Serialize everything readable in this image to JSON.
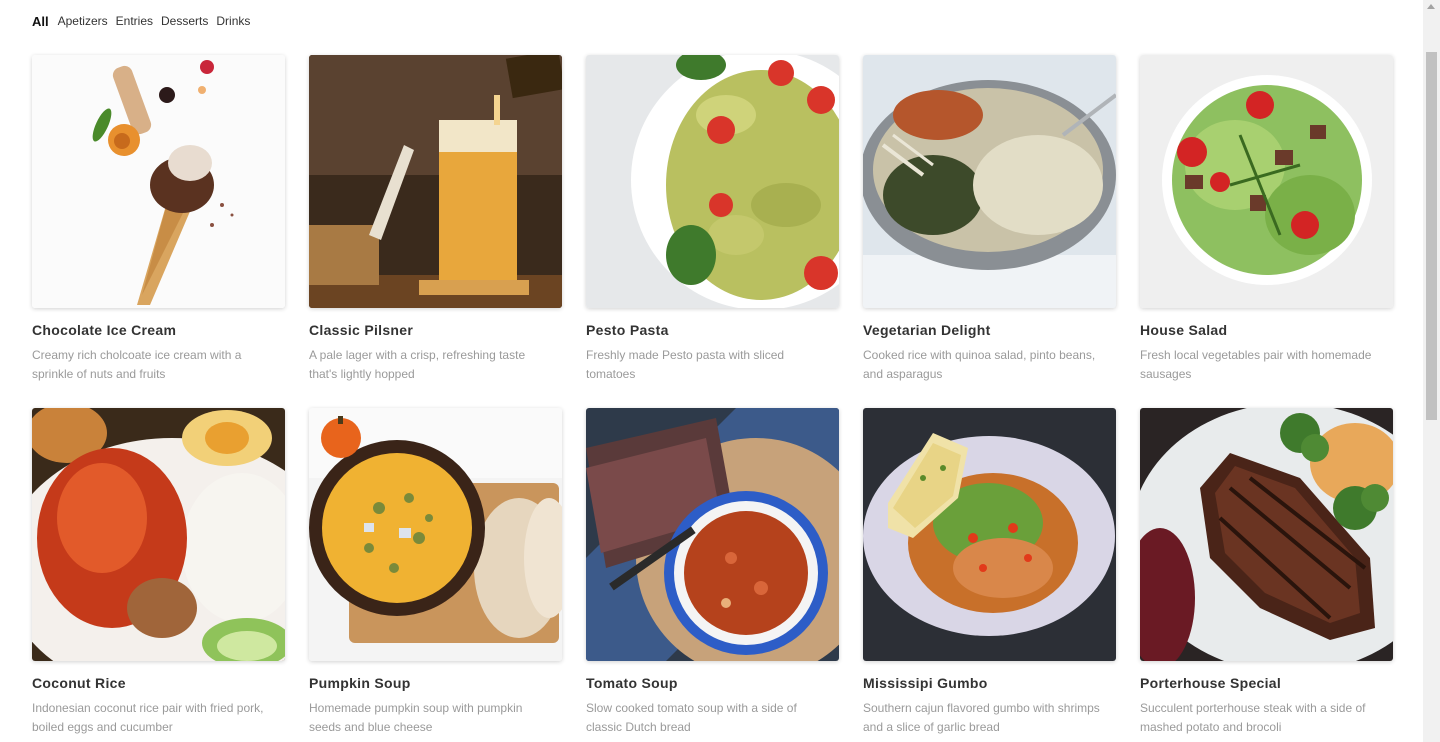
{
  "filters": [
    {
      "label": "All",
      "active": true
    },
    {
      "label": "Apetizers",
      "active": false
    },
    {
      "label": "Entries",
      "active": false
    },
    {
      "label": "Desserts",
      "active": false
    },
    {
      "label": "Drinks",
      "active": false
    }
  ],
  "menu": [
    {
      "title": "Chocolate Ice Cream",
      "desc": "Creamy rich cholcoate ice cream with a sprinkle of nuts and fruits",
      "image": "ice-cream-cone-image"
    },
    {
      "title": "Classic Pilsner",
      "desc": "A pale lager with a crisp, refreshing taste that's lightly hopped",
      "image": "beer-glass-image"
    },
    {
      "title": "Pesto Pasta",
      "desc": "Freshly made Pesto pasta with sliced tomatoes",
      "image": "pesto-pasta-plate-image"
    },
    {
      "title": "Vegetarian Delight",
      "desc": "Cooked rice with quinoa salad, pinto beans, and asparagus",
      "image": "vegetarian-pan-image"
    },
    {
      "title": "House Salad",
      "desc": "Fresh local vegetables pair with homemade sausages",
      "image": "salad-bowl-image"
    },
    {
      "title": "Coconut Rice",
      "desc": "Indonesian coconut rice pair with fried pork, boiled eggs and cucumber",
      "image": "coconut-rice-plate-image"
    },
    {
      "title": "Pumpkin Soup",
      "desc": "Homemade pumpkin soup with pumpkin seeds and blue cheese",
      "image": "pumpkin-soup-bowl-image"
    },
    {
      "title": "Tomato Soup",
      "desc": "Slow cooked tomato soup with a side of classic Dutch bread",
      "image": "tomato-soup-bowl-image"
    },
    {
      "title": "Mississipi Gumbo",
      "desc": "Southern cajun flavored gumbo with shrimps and a slice of garlic bread",
      "image": "gumbo-plate-image"
    },
    {
      "title": "Porterhouse Special",
      "desc": "Succulent porterhouse steak with a side of mashed potato and brocoli",
      "image": "steak-plate-image"
    }
  ]
}
